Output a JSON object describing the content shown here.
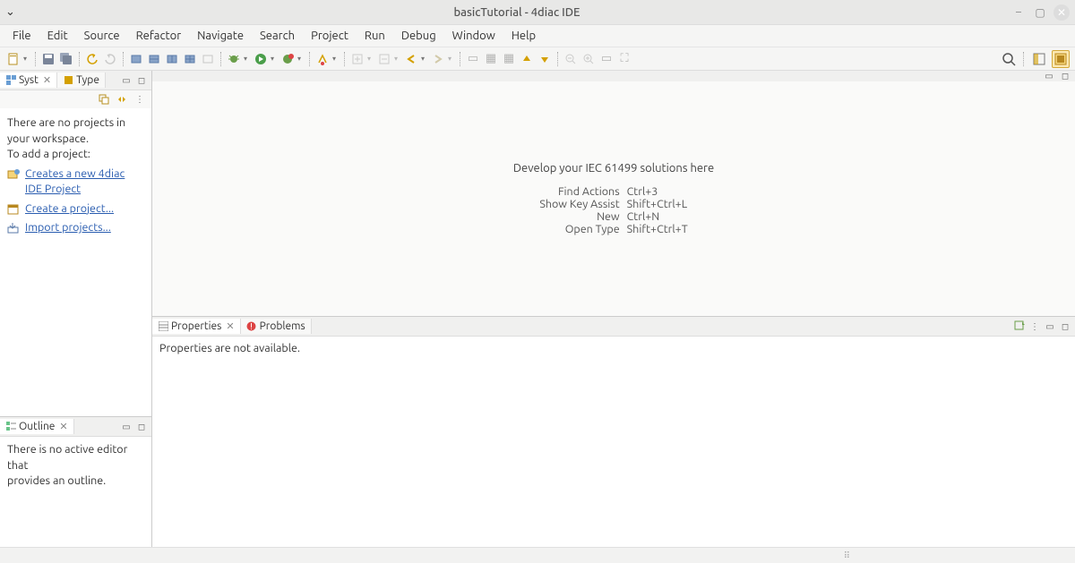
{
  "window": {
    "title": "basicTutorial - 4diac IDE"
  },
  "menu": {
    "items": [
      "File",
      "Edit",
      "Source",
      "Refactor",
      "Navigate",
      "Search",
      "Project",
      "Run",
      "Debug",
      "Window",
      "Help"
    ]
  },
  "leftTabs": {
    "syst": "Syst",
    "type": "Type"
  },
  "projectPanel": {
    "noProjects1": "There are no projects in",
    "noProjects2": "your workspace.",
    "addProject": "To add a project:",
    "link1a": "Creates a new 4diac",
    "link1b": "IDE Project",
    "link2": "Create a project...",
    "link3": "Import projects..."
  },
  "outline": {
    "tab": "Outline",
    "body1": "There is no active editor that",
    "body2": "provides an outline."
  },
  "editor": {
    "heading": "Develop your IEC 61499 solutions here",
    "shortcuts": [
      {
        "label": "Find Actions",
        "key": "Ctrl+3"
      },
      {
        "label": "Show Key Assist",
        "key": "Shift+Ctrl+L"
      },
      {
        "label": "New",
        "key": "Ctrl+N"
      },
      {
        "label": "Open Type",
        "key": "Shift+Ctrl+T"
      }
    ]
  },
  "bottom": {
    "properties": "Properties",
    "problems": "Problems",
    "body": "Properties are not available."
  }
}
